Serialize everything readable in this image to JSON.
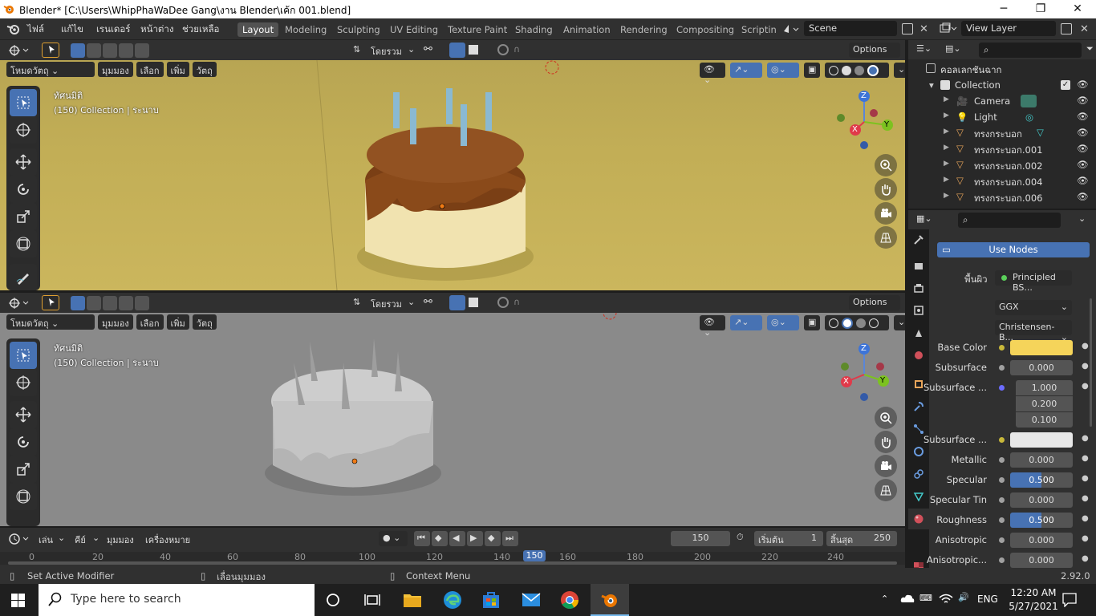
{
  "window": {
    "title": "Blender* [C:\\Users\\WhipPhaWaDee Gang\\งาน Blender\\เค้ก 001.blend]",
    "minimize": "─",
    "maximize": "❐",
    "close": "✕"
  },
  "menu": [
    "ไฟล์",
    "แก้ไข",
    "เรนเดอร์",
    "หน้าต่าง",
    "ช่วยเหลือ"
  ],
  "workspaces": [
    "Layout",
    "Modeling",
    "Sculpting",
    "UV Editing",
    "Texture Paint",
    "Shading",
    "Animation",
    "Rendering",
    "Compositing",
    "Scriptin"
  ],
  "active_workspace": "Layout",
  "scene": "Scene",
  "view_layer": "View Layer",
  "viewport": {
    "transform_orientation": "โดยรวม",
    "options": "Options",
    "mode": "โหมดวัตถุ",
    "view_menus": [
      "มุมมอง",
      "เลือก",
      "เพิ่ม",
      "วัตถุ"
    ],
    "view_name": "ทัศนมิติ",
    "collection_info": "(150) Collection | ระนาบ",
    "axes": {
      "x": "X",
      "y": "Y",
      "z": "Z"
    }
  },
  "outliner": {
    "root": "คอลเลกชันฉาก",
    "items": [
      {
        "name": "Collection",
        "level": 1
      },
      {
        "name": "Camera",
        "level": 2
      },
      {
        "name": "Light",
        "level": 2
      },
      {
        "name": "ทรงกระบอก",
        "level": 2
      },
      {
        "name": "ทรงกระบอก.001",
        "level": 2
      },
      {
        "name": "ทรงกระบอก.002",
        "level": 2
      },
      {
        "name": "ทรงกระบอก.004",
        "level": 2
      },
      {
        "name": "ทรงกระบอก.006",
        "level": 2
      }
    ]
  },
  "properties": {
    "use_nodes": "Use Nodes",
    "surface_label": "พื้นผิว",
    "surface_value": "Principled BS...",
    "distribution": "GGX",
    "subsurface_method": "Christensen-B...",
    "rows": [
      {
        "label": "Base Color",
        "type": "color",
        "color": "#f5d45a",
        "dot": "#c8b83a"
      },
      {
        "label": "Subsurface",
        "value": "0.000",
        "dot": "#a0a0a0"
      },
      {
        "label": "Subsurface ...",
        "values": [
          "1.000",
          "0.200",
          "0.100"
        ],
        "dot": "#6c6cff"
      },
      {
        "label": "Subsurface ...",
        "type": "color",
        "color": "#e8e8e8",
        "dot": "#c8b83a"
      },
      {
        "label": "Metallic",
        "value": "0.000",
        "dot": "#a0a0a0"
      },
      {
        "label": "Specular",
        "value": "0.500",
        "fill": 0.5,
        "dot": "#a0a0a0"
      },
      {
        "label": "Specular Tin",
        "value": "0.000",
        "dot": "#a0a0a0"
      },
      {
        "label": "Roughness",
        "value": "0.500",
        "fill": 0.5,
        "dot": "#a0a0a0"
      },
      {
        "label": "Anisotropic",
        "value": "0.000",
        "dot": "#a0a0a0"
      },
      {
        "label": "Anisotropic...",
        "value": "0.000",
        "dot": "#a0a0a0"
      }
    ]
  },
  "timeline": {
    "menus": [
      "เล่น",
      "คีย์",
      "มุมมอง",
      "เครื่องหมาย"
    ],
    "current_frame": "150",
    "start_label": "เริ่มต้น",
    "start": "1",
    "end_label": "สิ้นสุด",
    "end": "250",
    "ruler": [
      "0",
      "20",
      "40",
      "60",
      "80",
      "100",
      "120",
      "140",
      "150",
      "160",
      "180",
      "200",
      "220",
      "240"
    ]
  },
  "status": {
    "left": "Set Active Modifier",
    "middle": "เลื่อนมุมมอง",
    "right": "Context Menu",
    "version": "2.92.0"
  },
  "taskbar": {
    "search": "Type here to search",
    "lang": "ENG",
    "time": "12:20 AM",
    "date": "5/27/2021"
  }
}
